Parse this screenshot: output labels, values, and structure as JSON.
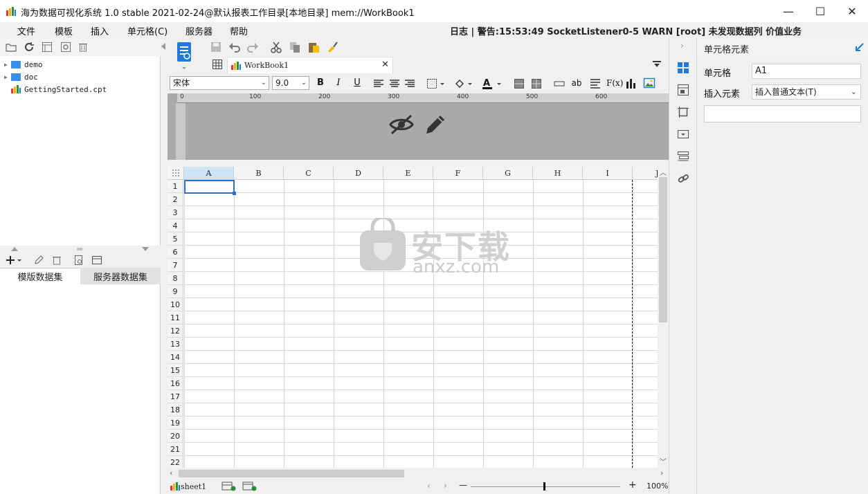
{
  "window": {
    "title": "海为数据可视化系统 1.0 stable 2021-02-24@默认报表工作目录[本地目录]     mem://WorkBook1",
    "minimize": "—",
    "maximize": "☐",
    "close": "✕"
  },
  "menu": {
    "items": [
      "文件",
      "模板",
      "插入",
      "单元格(C)",
      "服务器",
      "帮助"
    ],
    "log_status": "日志 | 警告:15:53:49 SocketListener0-5 WARN [root] 未发现数据列 价值业务"
  },
  "left_panel": {
    "tree": [
      {
        "label": "demo",
        "type": "folder"
      },
      {
        "label": "doc",
        "type": "folder"
      },
      {
        "label": "GettingStarted.cpt",
        "type": "file"
      }
    ],
    "dataset_tabs": [
      "模版数据集",
      "服务器数据集"
    ]
  },
  "editor": {
    "doc_tab": "WorkBook1",
    "font_name": "宋体",
    "font_size": "9.0",
    "ruler_labels": [
      "0",
      "100",
      "200",
      "300",
      "400",
      "500",
      "600"
    ],
    "columns": [
      "A",
      "B",
      "C",
      "D",
      "E",
      "F",
      "G",
      "H",
      "I",
      "J"
    ],
    "rows": [
      "1",
      "2",
      "3",
      "4",
      "5",
      "6",
      "7",
      "8",
      "9",
      "10",
      "11",
      "12",
      "13",
      "14",
      "15",
      "16",
      "17",
      "18",
      "19",
      "20",
      "21",
      "22"
    ],
    "sheet_tab": "sheet1",
    "zoom": "100%",
    "zoom_minus": "—",
    "zoom_plus": "+"
  },
  "watermark": {
    "text_cn": "安下载",
    "text_en": "anxz.com"
  },
  "right_panel": {
    "header": "单元格元素",
    "cell_label": "单元格",
    "cell_value": "A1",
    "insert_label": "插入元素",
    "insert_value": "插入普通文本(T)"
  },
  "colors": {
    "accent": "#1e7ad6",
    "selection": "#2a6fd0",
    "header_area": "#a9a9a9"
  }
}
